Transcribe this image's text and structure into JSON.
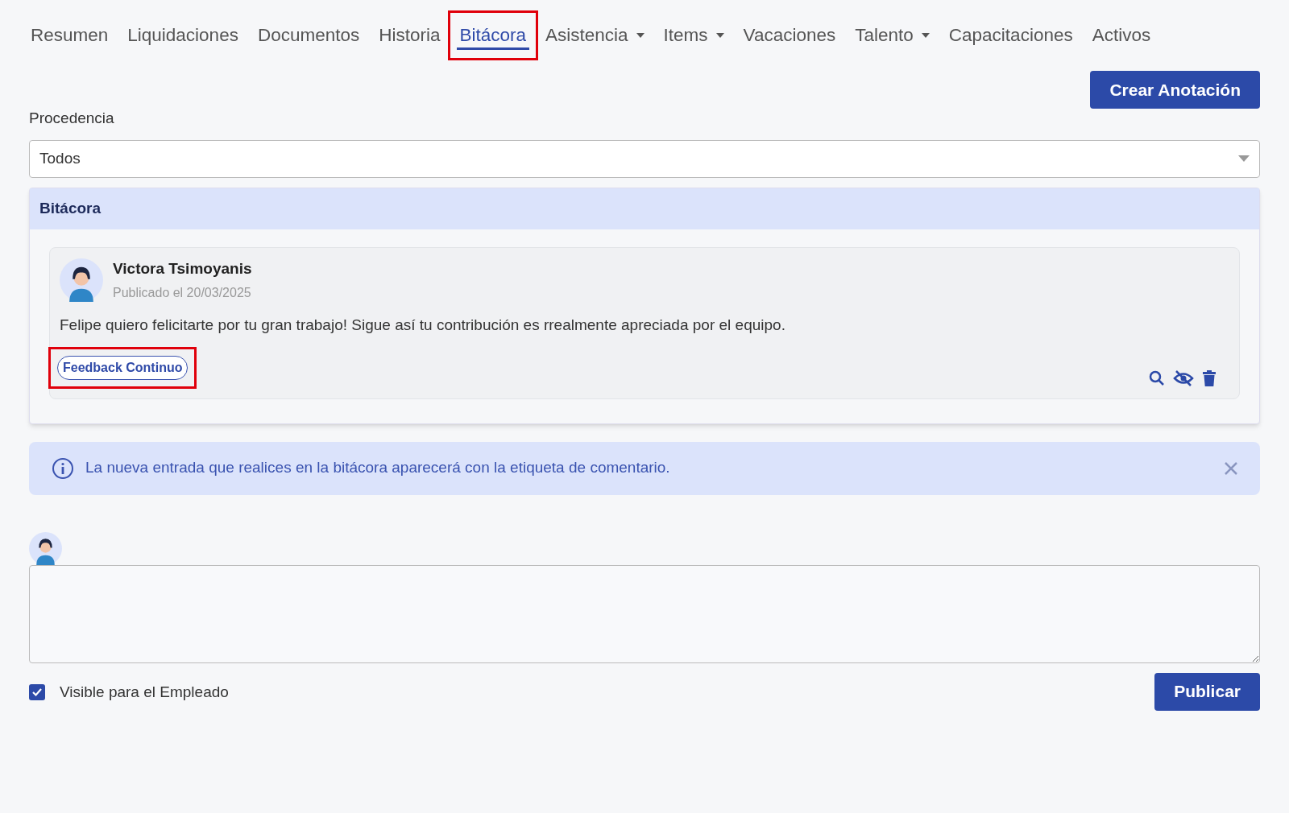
{
  "tabs": [
    {
      "label": "Resumen",
      "selected": false,
      "dropdown": false,
      "highlighted": false
    },
    {
      "label": "Liquidaciones",
      "selected": false,
      "dropdown": false,
      "highlighted": false
    },
    {
      "label": "Documentos",
      "selected": false,
      "dropdown": false,
      "highlighted": false
    },
    {
      "label": "Historia",
      "selected": false,
      "dropdown": false,
      "highlighted": false
    },
    {
      "label": "Bitácora",
      "selected": true,
      "dropdown": false,
      "highlighted": true
    },
    {
      "label": "Asistencia",
      "selected": false,
      "dropdown": true,
      "highlighted": false
    },
    {
      "label": "Items",
      "selected": false,
      "dropdown": true,
      "highlighted": false
    },
    {
      "label": "Vacaciones",
      "selected": false,
      "dropdown": false,
      "highlighted": false
    },
    {
      "label": "Talento",
      "selected": false,
      "dropdown": true,
      "highlighted": false
    },
    {
      "label": "Capacitaciones",
      "selected": false,
      "dropdown": false,
      "highlighted": false
    },
    {
      "label": "Activos",
      "selected": false,
      "dropdown": false,
      "highlighted": false
    }
  ],
  "create_button": "Crear Anotación",
  "filter": {
    "label": "Procedencia",
    "value": "Todos"
  },
  "log": {
    "title": "Bitácora",
    "entries": [
      {
        "author": "Victora Tsimoyanis",
        "date": "Publicado el 20/03/2025",
        "text": "Felipe quiero felicitarte por tu gran trabajo! Sigue así tu contribución es rrealmente apreciada por el equipo.",
        "tag": "Feedback Continuo",
        "tag_highlighted": true
      }
    ]
  },
  "alert": "La nueva entrada que realices en la bitácora aparecerá con la etiqueta de comentario.",
  "composer": {
    "visible_checkbox": {
      "label": "Visible para el Empleado",
      "checked": true
    },
    "submit": "Publicar"
  }
}
